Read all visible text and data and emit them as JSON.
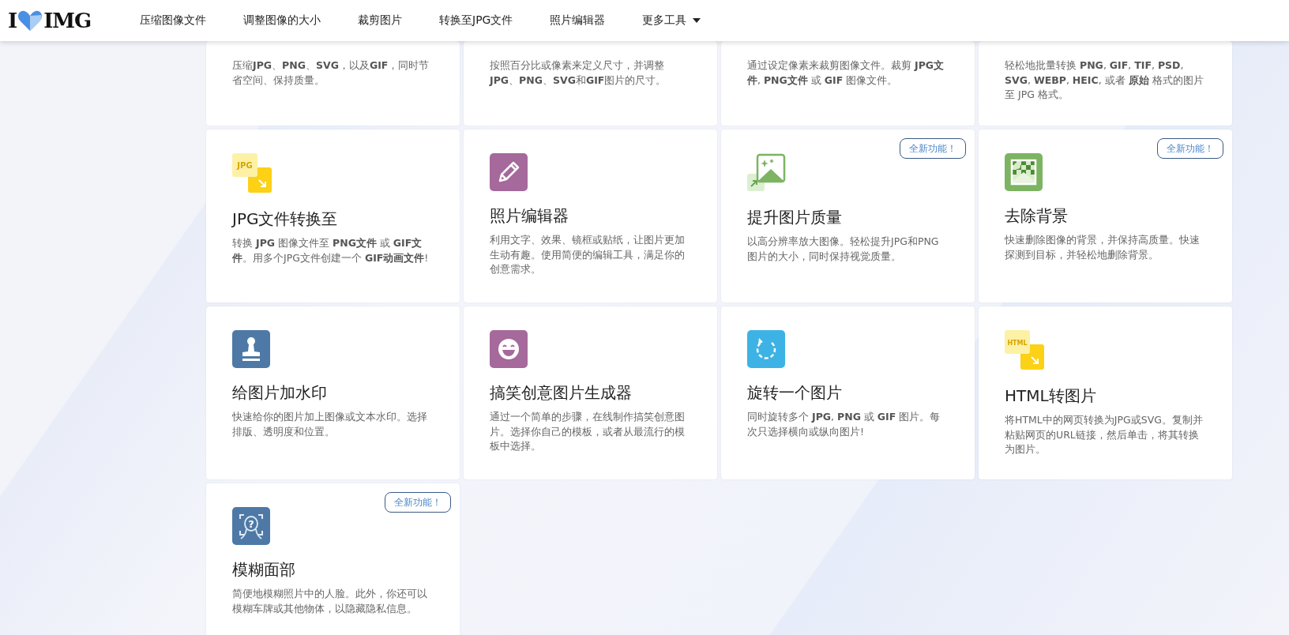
{
  "header": {
    "logo": {
      "left": "I",
      "right": "IMG"
    },
    "nav": [
      {
        "label": "压缩图像文件",
        "dropdown": false
      },
      {
        "label": "调整图像的大小",
        "dropdown": false
      },
      {
        "label": "裁剪图片",
        "dropdown": false
      },
      {
        "label": "转换至JPG文件",
        "dropdown": false
      },
      {
        "label": "照片编辑器",
        "dropdown": false
      },
      {
        "label": "更多工具",
        "dropdown": true
      }
    ]
  },
  "cut_off_cards": [
    {
      "description": "压缩**JPG**、**PNG**、**SVG**，以及**GIF**，同时节省空间、保持质量。"
    },
    {
      "description": "按照百分比或像素来定义尺寸，并调整**JPG**、**PNG**、**SVG**和**GIF**图片的尺寸。"
    },
    {
      "description": "通过设定像素来裁剪图像文件。裁剪 **JPG文件**, **PNG文件** 或 **GIF** 图像文件。"
    },
    {
      "description": "轻松地批量转换 **PNG**, **GIF**, **TIF**, **PSD**, **SVG**, **WEBP**, **HEIC**, 或者 **原始** 格式的图片至 JPG 格式。"
    }
  ],
  "cards": [
    {
      "kind": "format",
      "icon_text": "JPG",
      "title": "JPG文件转换至",
      "description": "转换 **JPG** 图像文件至 **PNG文件** 或 **GIF文件**。用多个JPG文件创建一个 **GIF动画文件**!"
    },
    {
      "kind": "pencil",
      "title": "照片编辑器",
      "description": "利用文字、效果、镜框或贴纸，让图片更加生动有趣。使用简便的编辑工具，满足你的创意需求。"
    },
    {
      "kind": "upscale",
      "badge": "全新功能！",
      "title": "提升图片质量",
      "description": "以高分辨率放大图像。轻松提升JPG和PNG图片的大小，同时保持视觉质量。"
    },
    {
      "kind": "checker",
      "badge": "全新功能！",
      "title": "去除背景",
      "description": "快速删除图像的背景，并保持高质量。快速探测到目标，并轻松地删除背景。"
    },
    {
      "kind": "stamp",
      "title": "给图片加水印",
      "description": "快速给你的图片加上图像或文本水印。选择排版、透明度和位置。"
    },
    {
      "kind": "smile",
      "title": "搞笑创意图片生成器",
      "description": "通过一个简单的步骤，在线制作搞笑创意图片。选择你自己的模板，或者从最流行的模板中选择。"
    },
    {
      "kind": "rotate",
      "title": "旋转一个图片",
      "description": "同时旋转多个 **JPG**, **PNG** 或 **GIF** 图片。每次只选择横向或纵向图片!"
    },
    {
      "kind": "format",
      "icon_text": "HTML",
      "title": "HTML转图片",
      "description": "将HTML中的网页转换为JPG或SVG。复制并粘贴网页的URL链接，然后单击，将其转换为图片。"
    },
    {
      "kind": "face",
      "icon_text": "?",
      "badge": "全新功能！",
      "title": "模糊面部",
      "description": "简便地模糊照片中的人脸。此外，你还可以模糊车牌或其他物体，以隐藏隐私信息。"
    }
  ]
}
